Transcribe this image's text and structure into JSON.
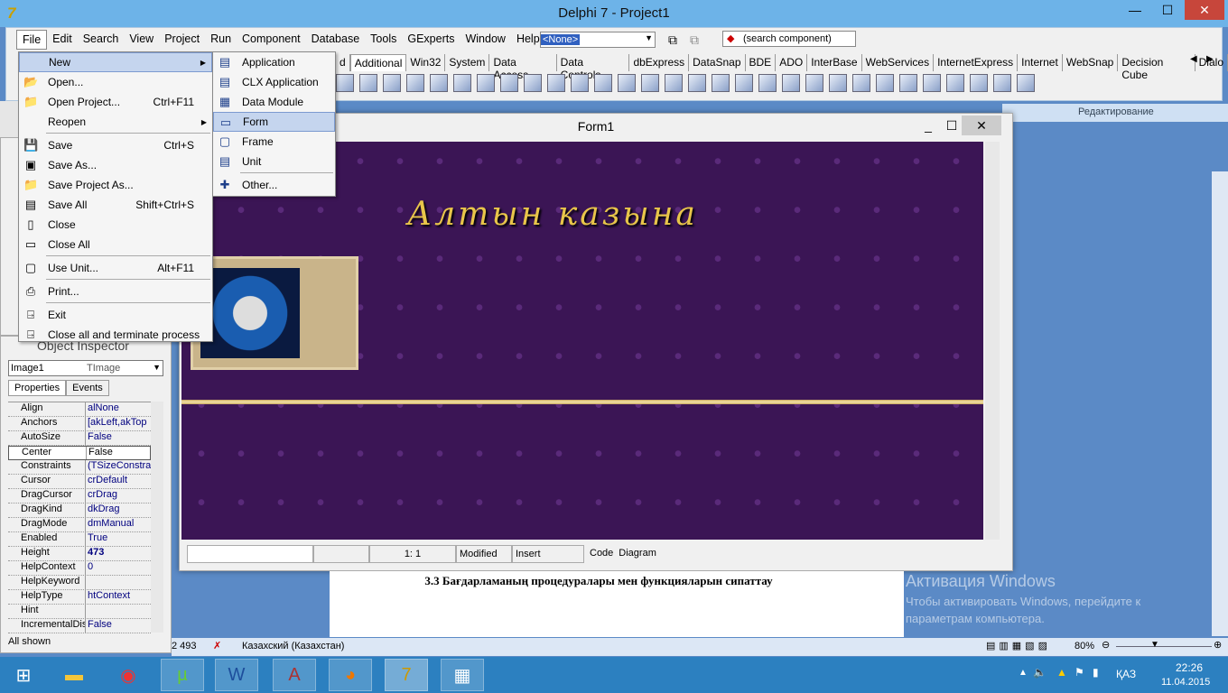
{
  "window": {
    "title": "Delphi 7 - Project1",
    "minimize": "—",
    "maximize": "☐",
    "close": "✕"
  },
  "menubar": [
    "File",
    "Edit",
    "Search",
    "View",
    "Project",
    "Run",
    "Component",
    "Database",
    "Tools",
    "GExperts",
    "Window",
    "Help"
  ],
  "toolbar": {
    "config_combo": "<None>",
    "search_component": "(search component)"
  },
  "palette_tabs": [
    "d",
    "Additional",
    "Win32",
    "System",
    "Data Access",
    "Data Controls",
    "dbExpress",
    "DataSnap",
    "BDE",
    "ADO",
    "InterBase",
    "WebServices",
    "InternetExpress",
    "Internet",
    "WebSnap",
    "Decision Cube",
    "Dialo"
  ],
  "word_ribbon": {
    "editing": "Редактирование"
  },
  "file_menu": [
    {
      "label": "New",
      "shortcut": "",
      "submenu": true,
      "icon": "new-icon"
    },
    {
      "label": "Open...",
      "shortcut": "",
      "icon": "open-icon"
    },
    {
      "label": "Open Project...",
      "shortcut": "Ctrl+F11",
      "icon": "open-project-icon"
    },
    {
      "label": "Reopen",
      "shortcut": "",
      "submenu": true,
      "icon": ""
    },
    {
      "label": "Save",
      "shortcut": "Ctrl+S",
      "icon": "save-icon"
    },
    {
      "label": "Save As...",
      "shortcut": "",
      "icon": "save-as-icon"
    },
    {
      "label": "Save Project As...",
      "shortcut": "",
      "icon": "save-project-icon"
    },
    {
      "label": "Save All",
      "shortcut": "Shift+Ctrl+S",
      "icon": "save-all-icon"
    },
    {
      "label": "Close",
      "shortcut": "",
      "icon": "close-file-icon"
    },
    {
      "label": "Close All",
      "shortcut": "",
      "icon": "close-all-icon"
    },
    {
      "label": "Use Unit...",
      "shortcut": "Alt+F11",
      "icon": "use-unit-icon"
    },
    {
      "label": "Print...",
      "shortcut": "",
      "icon": "print-icon"
    },
    {
      "label": "Exit",
      "shortcut": "",
      "icon": "exit-icon"
    },
    {
      "label": "Close all and terminate process",
      "shortcut": "",
      "icon": "terminate-icon"
    }
  ],
  "new_submenu": [
    "Application",
    "CLX Application",
    "Data Module",
    "Form",
    "Frame",
    "Unit",
    "Other..."
  ],
  "object_inspector": {
    "title": "Object Inspector",
    "selected": "Image1",
    "selected_type": "TImage",
    "tabs": [
      "Properties",
      "Events"
    ],
    "properties": [
      [
        "Align",
        "alNone"
      ],
      [
        "Anchors",
        "[akLeft,akTop"
      ],
      [
        "AutoSize",
        "False"
      ],
      [
        "Center",
        "False"
      ],
      [
        "Constraints",
        "(TSizeConstra"
      ],
      [
        "Cursor",
        "crDefault"
      ],
      [
        "DragCursor",
        "crDrag"
      ],
      [
        "DragKind",
        "dkDrag"
      ],
      [
        "DragMode",
        "dmManual"
      ],
      [
        "Enabled",
        "True"
      ],
      [
        "Height",
        "473"
      ],
      [
        "HelpContext",
        "0"
      ],
      [
        "HelpKeyword",
        ""
      ],
      [
        "HelpType",
        "htContext"
      ],
      [
        "Hint",
        ""
      ],
      [
        "IncrementalDisp",
        "False"
      ]
    ],
    "footer": "All shown"
  },
  "form1": {
    "title": "Form1",
    "logo_text": "Алтын казына",
    "status": {
      "position": "1:  1",
      "modified": "Modified",
      "mode": "Insert",
      "tab_code": "Code",
      "tab_diagram": "Diagram"
    }
  },
  "word": {
    "heading": "3.3 Бағдарламаның процедуралары мен функцияларын сипаттау",
    "word_count": "2 493",
    "language": "Казахский (Казахстан)",
    "zoom": "80%"
  },
  "activation": {
    "title": "Активация Windows",
    "line1": "Чтобы активировать Windows, перейдите к",
    "line2": "параметрам компьютера."
  },
  "tray": {
    "lang": "ҚАЗ",
    "time": "22:26",
    "date": "11.04.2015"
  }
}
